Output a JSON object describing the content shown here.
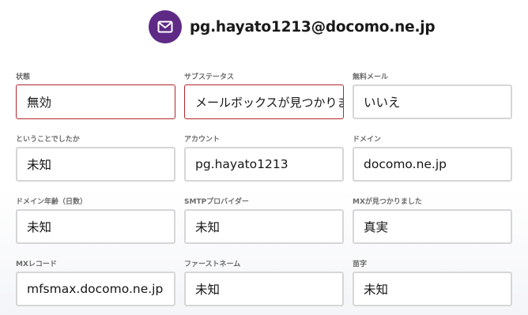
{
  "header": {
    "icon": "mail-icon",
    "accent_color": "#5e2a86",
    "email": "pg.hayato1213@docomo.ne.jp"
  },
  "fields": [
    {
      "label": "状態",
      "value": "無効",
      "state": "error"
    },
    {
      "label": "サブステータス",
      "value": "メールボックスが見つかりません",
      "state": "error"
    },
    {
      "label": "無料メール",
      "value": "いいえ",
      "state": "normal"
    },
    {
      "label": "ということでしたか",
      "value": "未知",
      "state": "normal"
    },
    {
      "label": "アカウント",
      "value": "pg.hayato1213",
      "state": "normal"
    },
    {
      "label": "ドメイン",
      "value": "docomo.ne.jp",
      "state": "normal"
    },
    {
      "label": "ドメイン年齢（日数）",
      "value": "未知",
      "state": "normal"
    },
    {
      "label": "SMTPプロバイダー",
      "value": "未知",
      "state": "normal"
    },
    {
      "label": "MXが見つかりました",
      "value": "真実",
      "state": "normal"
    },
    {
      "label": "MXレコード",
      "value": "mfsmax.docomo.ne.jp",
      "state": "normal"
    },
    {
      "label": "ファーストネーム",
      "value": "未知",
      "state": "normal"
    },
    {
      "label": "苗字",
      "value": "未知",
      "state": "normal"
    }
  ]
}
